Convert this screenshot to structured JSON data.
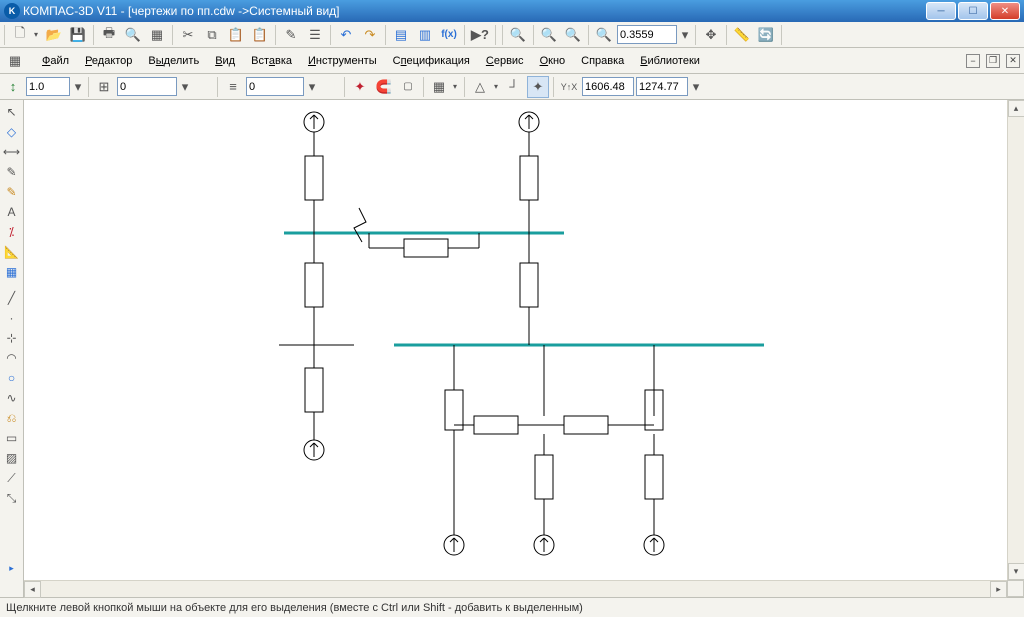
{
  "window": {
    "title": "КОМПАС-3D V11 - [чертежи по пп.cdw ->Системный вид]"
  },
  "toolbar1": {
    "zoom": "0.3559"
  },
  "menu": {
    "file": "Файл",
    "editor": "Редактор",
    "select": "Выделить",
    "view": "Вид",
    "insert": "Вставка",
    "tools": "Инструменты",
    "spec": "Спецификация",
    "service": "Сервис",
    "window": "Окно",
    "help": "Справка",
    "libs": "Библиотеки"
  },
  "toolbar3": {
    "scale": "1.0",
    "step": "0",
    "layer": "0",
    "coord_x": "1606.48",
    "coord_y": "1274.77"
  },
  "status": "Щелкните левой кнопкой мыши на объекте для его выделения (вместе с Ctrl или Shift - добавить к выделенным)"
}
